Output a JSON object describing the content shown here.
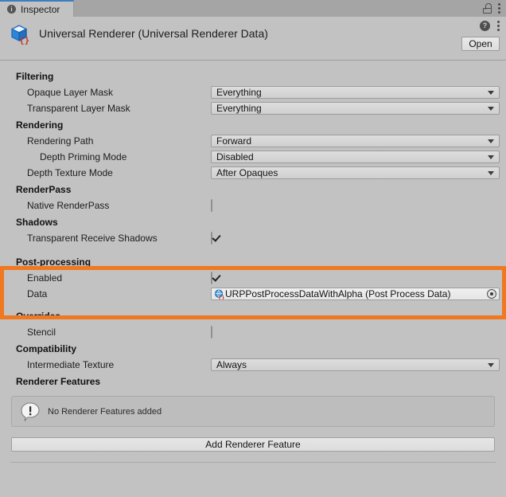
{
  "window": {
    "tab_label": "Inspector",
    "tab_icon": "info-icon",
    "lock_icon": "lock-icon",
    "menu_icon": "kebab-menu-icon"
  },
  "header": {
    "asset_icon": "scriptable-object-cube-icon",
    "title": "Universal Renderer (Universal Renderer Data)",
    "help_icon": "help-icon",
    "menu_icon": "kebab-menu-icon",
    "open_label": "Open"
  },
  "sections": {
    "filtering": {
      "title": "Filtering",
      "opaque_label": "Opaque Layer Mask",
      "opaque_value": "Everything",
      "transparent_label": "Transparent Layer Mask",
      "transparent_value": "Everything"
    },
    "rendering": {
      "title": "Rendering",
      "path_label": "Rendering Path",
      "path_value": "Forward",
      "priming_label": "Depth Priming Mode",
      "priming_value": "Disabled",
      "depth_texture_label": "Depth Texture Mode",
      "depth_texture_value": "After Opaques"
    },
    "renderpass": {
      "title": "RenderPass",
      "native_label": "Native RenderPass",
      "native_checked": false
    },
    "shadows": {
      "title": "Shadows",
      "transparent_receive_label": "Transparent Receive Shadows",
      "transparent_receive_checked": true
    },
    "postprocessing": {
      "title": "Post-processing",
      "enabled_label": "Enabled",
      "enabled_checked": true,
      "data_label": "Data",
      "data_value": "URPPostProcessDataWithAlpha (Post Process Data)",
      "data_icon": "post-process-data-asset-icon",
      "picker_icon": "object-picker-icon",
      "highlight_color": "#f07820"
    },
    "overrides": {
      "title": "Overrides",
      "stencil_label": "Stencil",
      "stencil_checked": false
    },
    "compatibility": {
      "title": "Compatibility",
      "intermediate_label": "Intermediate Texture",
      "intermediate_value": "Always"
    },
    "renderer_features": {
      "title": "Renderer Features",
      "helpbox_icon": "warning-bubble-icon",
      "helpbox_text": "No Renderer Features added",
      "add_label": "Add Renderer Feature"
    }
  }
}
